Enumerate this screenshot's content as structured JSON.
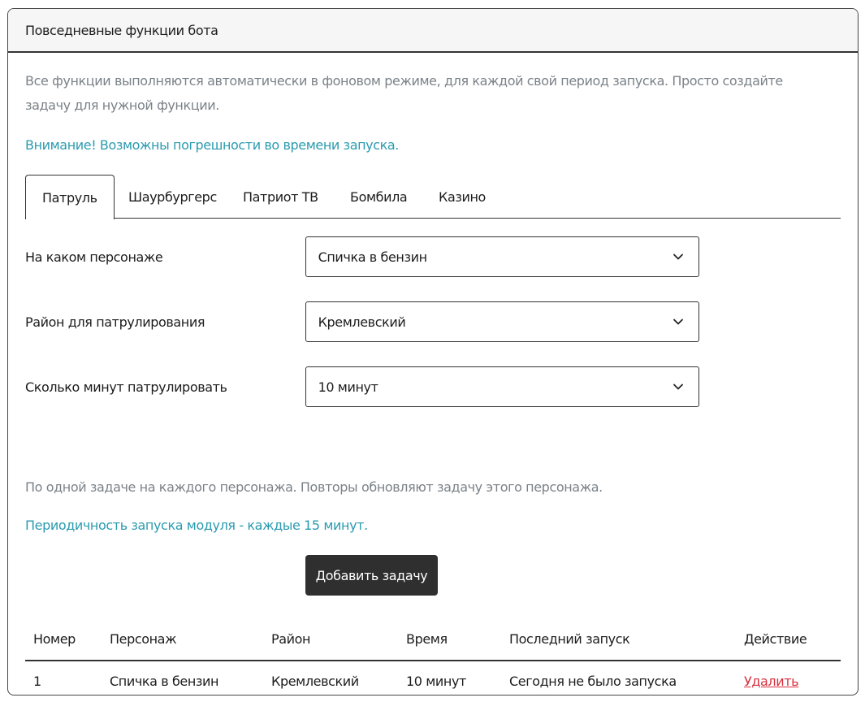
{
  "header": {
    "title": "Повседневные функции бота"
  },
  "intro": "Все функции выполняются автоматически в фоновом режиме, для каждой свой период запуска. Просто создайте задачу для нужной функции.",
  "warning": "Внимание! Возможны погрешности во времени запуска.",
  "tabs": [
    {
      "label": "Патруль",
      "active": true
    },
    {
      "label": "Шаурбургерс",
      "active": false
    },
    {
      "label": "Патриот ТВ",
      "active": false
    },
    {
      "label": "Бомбила",
      "active": false
    },
    {
      "label": "Казино",
      "active": false
    }
  ],
  "form": {
    "character": {
      "label": "На каком персонаже",
      "value": "Спичка в бензин"
    },
    "district": {
      "label": "Район для патрулирования",
      "value": "Кремлевский"
    },
    "minutes": {
      "label": "Сколько минут патрулировать",
      "value": "10 минут"
    }
  },
  "note": "По одной задаче на каждого персонажа. Повторы обновляют задачу этого персонажа.",
  "period": "Периодичность запуска модуля - каждые 15 минут.",
  "add_button": "Добавить задачу",
  "table": {
    "headers": [
      "Номер",
      "Персонаж",
      "Район",
      "Время",
      "Последний запуск",
      "Действие"
    ],
    "rows": [
      [
        "1",
        "Спичка в бензин",
        "Кремлевский",
        "10 минут",
        "Сегодня не было запуска",
        "Удалить"
      ]
    ]
  },
  "colors": {
    "info": "#2a9bb0",
    "muted": "#7a8288",
    "danger": "#d9303e",
    "button": "#2f2f2f"
  },
  "icons": {
    "select_arrow": "chevron-down-icon"
  }
}
